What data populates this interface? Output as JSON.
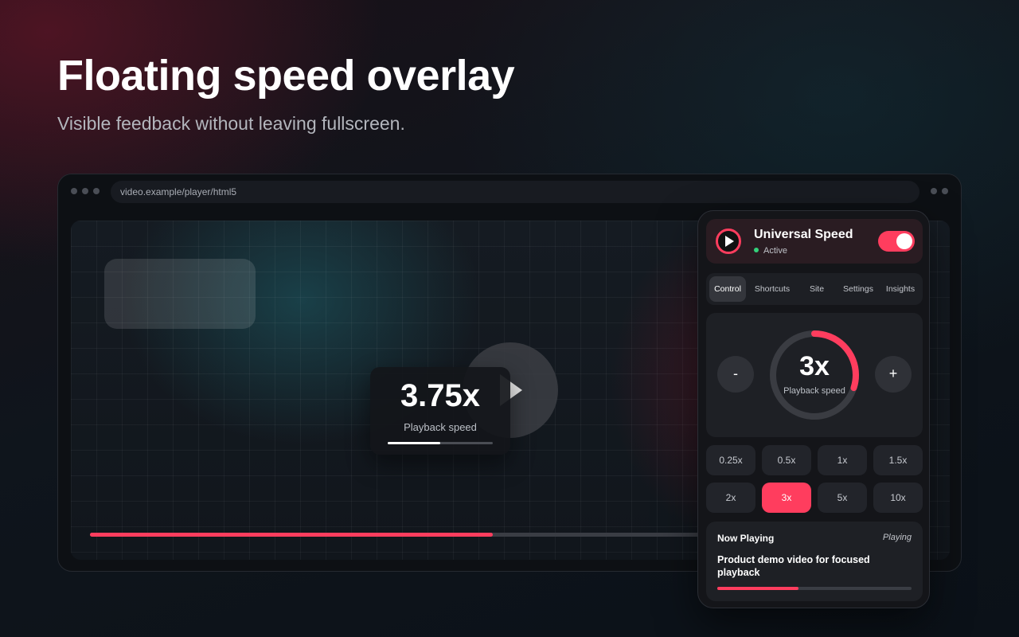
{
  "hero": {
    "title": "Floating speed overlay",
    "subtitle": "Visible feedback without leaving fullscreen."
  },
  "browser": {
    "url": "video.example/player/html5"
  },
  "player": {
    "overlay_speed": "3.75x",
    "overlay_label": "Playback speed",
    "overlay_indicator_fraction": 0.5,
    "progress_fraction": 0.64
  },
  "popup": {
    "app_name": "Universal Speed",
    "status": "Active",
    "enabled": true,
    "tabs": [
      {
        "label": "Control",
        "active": true
      },
      {
        "label": "Shortcuts",
        "active": false
      },
      {
        "label": "Site",
        "active": false
      },
      {
        "label": "Settings",
        "active": false
      },
      {
        "label": "Insights",
        "active": false
      }
    ],
    "control": {
      "decrease_label": "-",
      "increase_label": "+",
      "speed": "3x",
      "speed_label": "Playback speed",
      "dial_fraction": 0.3
    },
    "presets": [
      {
        "label": "0.25x",
        "active": false
      },
      {
        "label": "0.5x",
        "active": false
      },
      {
        "label": "1x",
        "active": false
      },
      {
        "label": "1.5x",
        "active": false
      },
      {
        "label": "2x",
        "active": false
      },
      {
        "label": "3x",
        "active": true
      },
      {
        "label": "5x",
        "active": false
      },
      {
        "label": "10x",
        "active": false
      }
    ],
    "now_playing": {
      "title": "Now Playing",
      "status": "Playing",
      "description": "Product demo video for focused playback",
      "progress_fraction": 0.42
    }
  },
  "colors": {
    "accent": "#ff3d5e",
    "active_dot": "#33d17a"
  }
}
